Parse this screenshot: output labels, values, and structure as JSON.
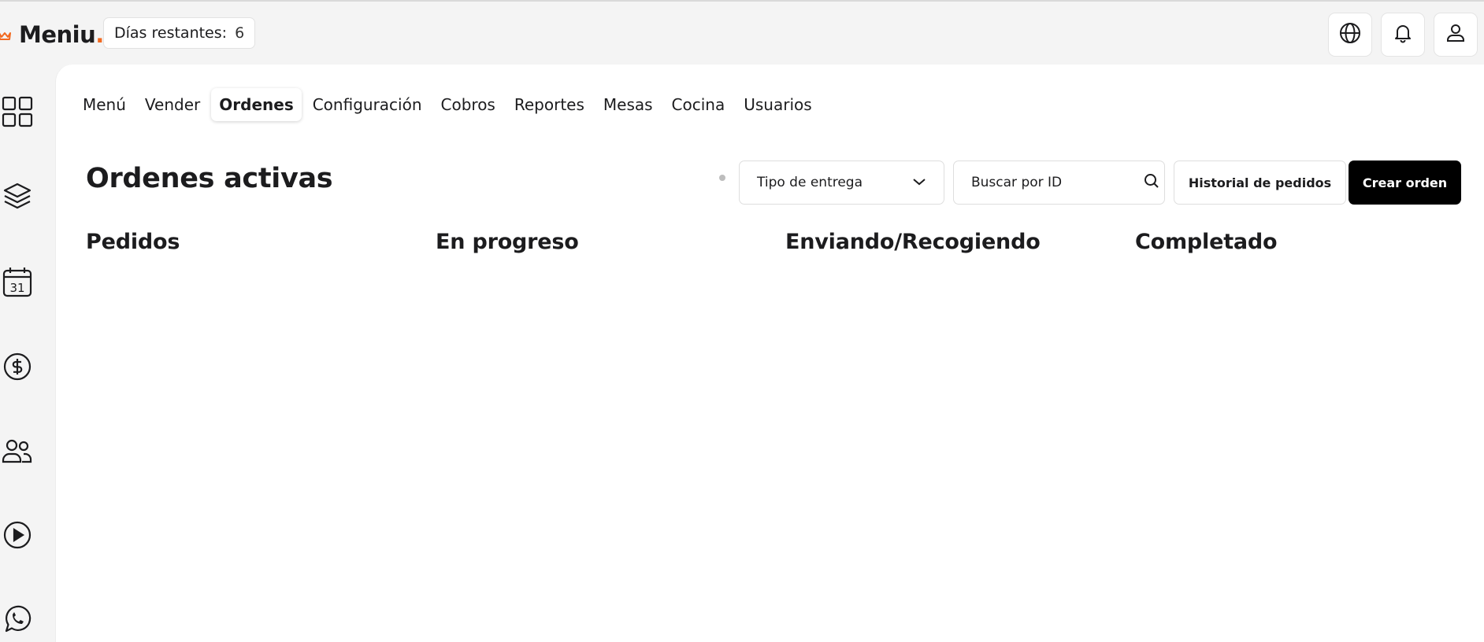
{
  "app": {
    "brand_name": "Meniu",
    "brand_dot": ".",
    "days_remaining_label": "Días restantes:",
    "days_remaining_value": "6"
  },
  "header_actions": [
    {
      "name": "language-button",
      "icon": "globe-icon"
    },
    {
      "name": "notifications-button",
      "icon": "bell-icon"
    },
    {
      "name": "profile-button",
      "icon": "user-icon"
    }
  ],
  "sidebar": {
    "items": [
      {
        "icon": "grid-icon"
      },
      {
        "icon": "layers-icon"
      },
      {
        "icon": "calendar-icon",
        "text": "31"
      },
      {
        "icon": "dollar-circle-icon"
      },
      {
        "icon": "users-icon"
      },
      {
        "icon": "play-circle-icon"
      },
      {
        "icon": "whatsapp-icon"
      }
    ]
  },
  "tabs": [
    {
      "label": "Menú"
    },
    {
      "label": "Vender"
    },
    {
      "label": "Ordenes",
      "active": true
    },
    {
      "label": "Configuración"
    },
    {
      "label": "Cobros"
    },
    {
      "label": "Reportes"
    },
    {
      "label": "Mesas"
    },
    {
      "label": "Cocina"
    },
    {
      "label": "Usuarios"
    }
  ],
  "page": {
    "title": "Ordenes activas",
    "delivery_select": {
      "value": "Tipo de entrega"
    },
    "search": {
      "placeholder": "Buscar por ID"
    },
    "history_button": "Historial de pedidos",
    "create_button": "Crear orden"
  },
  "columns": [
    {
      "title": "Pedidos"
    },
    {
      "title": "En progreso"
    },
    {
      "title": "Enviando/Recogiendo"
    },
    {
      "title": "Completado"
    }
  ],
  "colors": {
    "accent": "#f26a21",
    "primary_button": "#000000",
    "background": "#f4f4f4"
  }
}
